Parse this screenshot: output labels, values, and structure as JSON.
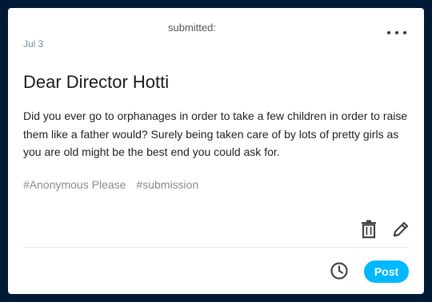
{
  "header": {
    "submitted_label": "submitted:",
    "date": "Jul 3"
  },
  "post": {
    "title": "Dear Director Hotti",
    "body": "Did you ever go to orphanages in order to take a few children in order to raise them like a father would? Surely being taken care of by lots of pretty girls as you are old might be the best end you could ask for.",
    "tags": [
      "#Anonymous Please",
      "#submission"
    ]
  },
  "actions": {
    "more_icon": "more-horizontal-icon",
    "delete_icon": "trash-icon",
    "edit_icon": "pencil-icon",
    "schedule_icon": "clock-icon",
    "post_label": "Post"
  },
  "colors": {
    "background": "#001935",
    "card": "#ffffff",
    "accent": "#00b8ff"
  }
}
